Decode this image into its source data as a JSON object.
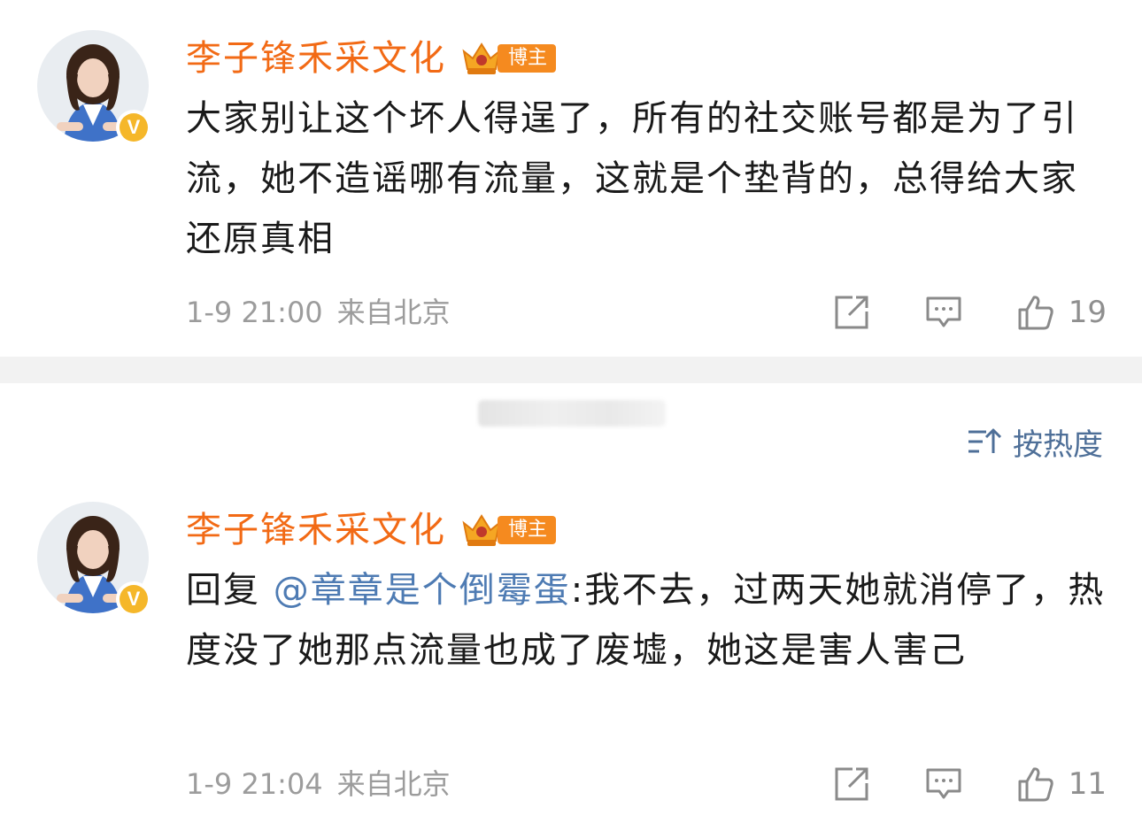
{
  "comments": [
    {
      "username": "李子锋禾采文化",
      "badge_label": "博主",
      "verified_mark": "V",
      "text_prefix": "",
      "mention": "",
      "text": "大家别让这个坏人得逞了，所有的社交账号都是为了引流，她不造谣哪有流量，这就是个垫背的，总得给大家还原真相",
      "timestamp": "1-9 21:00",
      "location": "来自北京",
      "likes": "19"
    },
    {
      "username": "李子锋禾采文化",
      "badge_label": "博主",
      "verified_mark": "V",
      "text_prefix": "回复 ",
      "mention": "@章章是个倒霉蛋",
      "text": ":我不去，过两天她就消停了，热度没了她那点流量也成了废墟，她这是害人害己",
      "timestamp": "1-9 21:04",
      "location": "来自北京",
      "likes": "11"
    }
  ],
  "sort": {
    "label": "按热度",
    "icon": "sort-icon"
  },
  "icons": [
    "share-icon",
    "comment-icon",
    "like-icon",
    "crown-icon",
    "verified-icon"
  ],
  "colors": {
    "username": "#f26a15",
    "mention": "#4e7bb3",
    "meta": "#9c9c9c",
    "badge": "#f58a1f",
    "verified": "#f5b72a",
    "sort": "#4e6f98"
  }
}
